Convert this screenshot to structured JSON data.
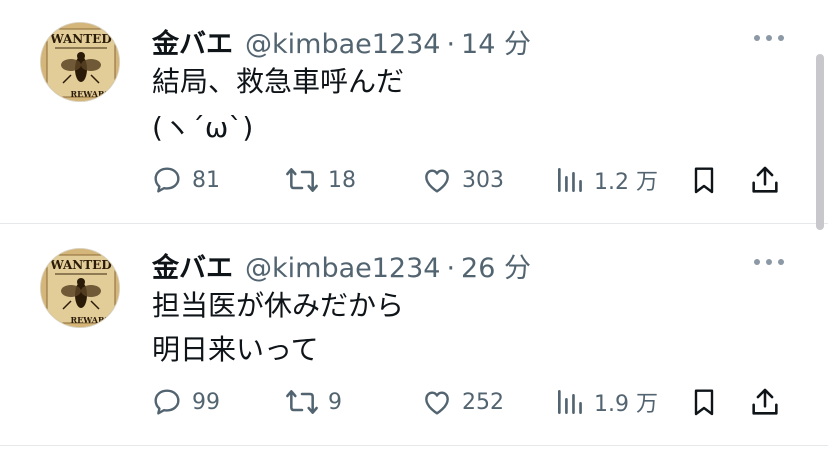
{
  "tweets": [
    {
      "name": "金バエ",
      "handle": "@kimbae1234",
      "separator": "·",
      "time": "14 分",
      "lines": [
        "結局、救急車呼んだ",
        "(ヽ´ω`)"
      ],
      "replies": "81",
      "retweets": "18",
      "likes": "303",
      "views": "1.2 万"
    },
    {
      "name": "金バエ",
      "handle": "@kimbae1234",
      "separator": "·",
      "time": "26 分",
      "lines": [
        "担当医が休みだから",
        "明日来いって"
      ],
      "replies": "99",
      "retweets": "9",
      "likes": "252",
      "views": "1.9 万"
    }
  ],
  "avatar_text": {
    "top": "WANTED",
    "bottom": "REWARD"
  },
  "icons": {
    "reply": "reply-icon",
    "retweet": "retweet-icon",
    "like": "heart-icon",
    "views": "views-icon",
    "bookmark": "bookmark-icon",
    "share": "share-icon",
    "more": "more-icon"
  },
  "colors": {
    "text": "#0f1419",
    "secondary": "#536471",
    "divider": "#e6e9eb"
  }
}
